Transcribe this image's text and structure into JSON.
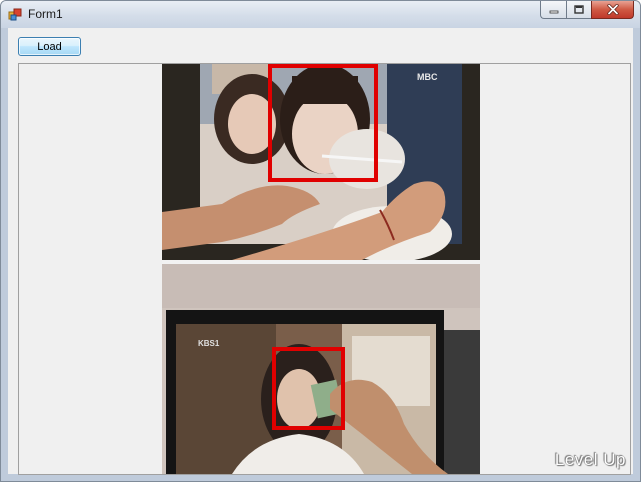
{
  "window": {
    "title": "Form1"
  },
  "toolbar": {
    "load_label": "Load"
  },
  "photo": {
    "top_panel": {
      "tv_logo": "MBC"
    },
    "bottom_panel": {
      "tv_logo": "KBS1"
    }
  },
  "watermark": "Level Up",
  "colors": {
    "face_box": "#e00000",
    "button_border": "#3c7fb1",
    "client_background": "#f0f0f0"
  },
  "icons": [
    "app-form-icon",
    "minimize-icon",
    "maximize-icon",
    "close-icon"
  ]
}
